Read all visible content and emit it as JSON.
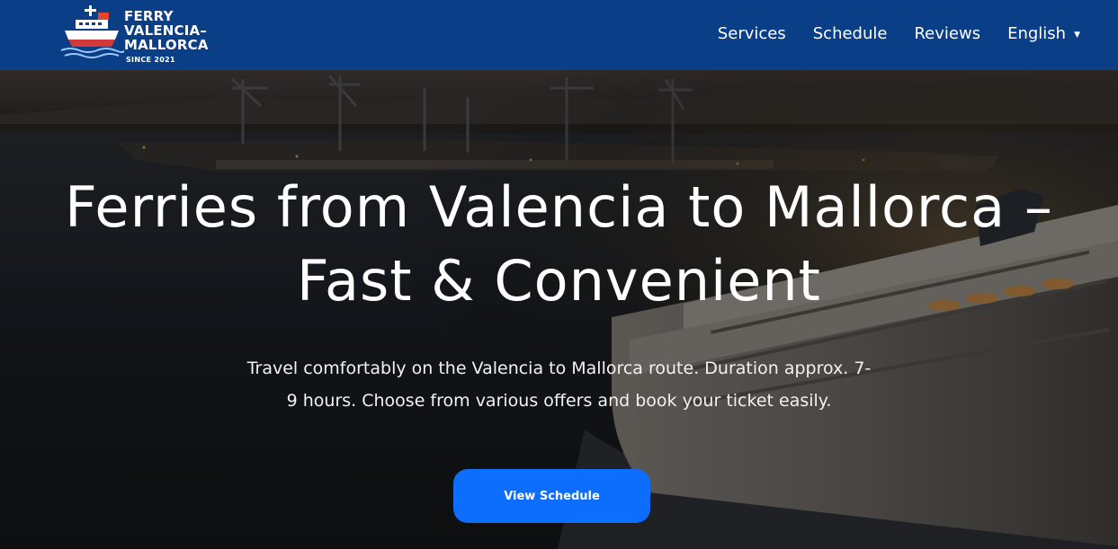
{
  "header": {
    "logo": {
      "line1": "FERRY",
      "line2": "VALENCIA–",
      "line3": "MALLORCA",
      "since": "SINCE 2021"
    },
    "nav": [
      {
        "label": "Services"
      },
      {
        "label": "Schedule"
      },
      {
        "label": "Reviews"
      },
      {
        "label": "English",
        "icon": "caret-down-icon"
      }
    ]
  },
  "hero": {
    "title_line1": "Ferries from Valencia to Mallorca –",
    "title_line2": "Fast & Convenient",
    "subtitle_line1": "Travel comfortably on the Valencia to Mallorca route. Duration approx. 7-",
    "subtitle_line2": "9 hours. Choose from various offers and book your ticket easily.",
    "cta_label": "View Schedule"
  },
  "colors": {
    "header_bg": "#0a3f87",
    "cta_bg": "#0d6efd",
    "text": "#ffffff"
  }
}
